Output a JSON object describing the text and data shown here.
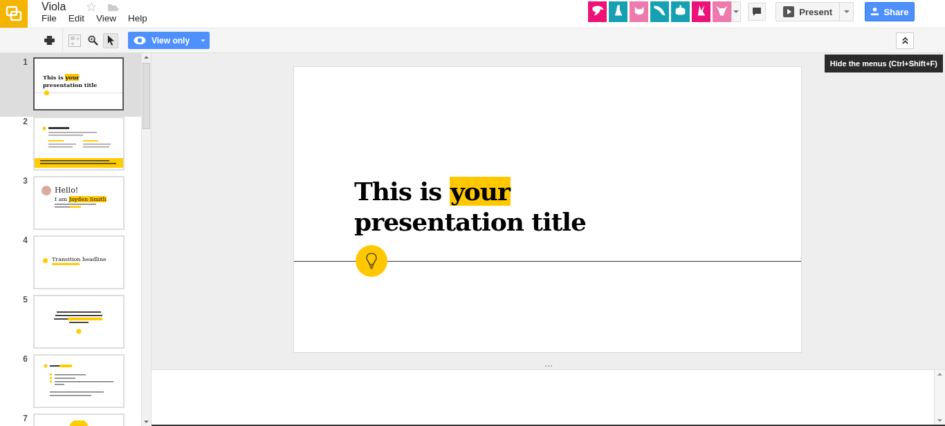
{
  "document": {
    "title": "Viola"
  },
  "menu": [
    "File",
    "Edit",
    "View",
    "Help"
  ],
  "collaborators": [
    {
      "color": "#ec1278"
    },
    {
      "color": "#17a0b2"
    },
    {
      "color": "#ee7aad"
    },
    {
      "color": "#17a0b2"
    },
    {
      "color": "#17a0b2"
    },
    {
      "color": "#ec1278"
    },
    {
      "color": "#ee7aad"
    }
  ],
  "present_button": "Present",
  "share_button": "Share",
  "toolbar": {
    "mode_button": "View only",
    "pointer_selected": true
  },
  "tooltip": "Hide the menus (Ctrl+Shift+F)",
  "slides": [
    {
      "number": "1",
      "selected": true,
      "kind": "title",
      "texts": [
        "This is ",
        "your",
        "presentation title"
      ]
    },
    {
      "number": "2",
      "selected": false,
      "kind": "instructions"
    },
    {
      "number": "3",
      "selected": false,
      "kind": "hello",
      "texts": [
        "Hello!",
        "I am ",
        "Jayden Smith"
      ]
    },
    {
      "number": "4",
      "selected": false,
      "kind": "transition",
      "texts": [
        "Transition headline"
      ]
    },
    {
      "number": "5",
      "selected": false,
      "kind": "quote"
    },
    {
      "number": "6",
      "selected": false,
      "kind": "list"
    },
    {
      "number": "7",
      "selected": false,
      "kind": "partial"
    }
  ],
  "current_slide": {
    "lines": [
      [
        {
          "text": "This is ",
          "highlight": false
        },
        {
          "text": "your",
          "highlight": true
        }
      ],
      [
        {
          "text": "presentation title",
          "highlight": false
        }
      ]
    ]
  }
}
